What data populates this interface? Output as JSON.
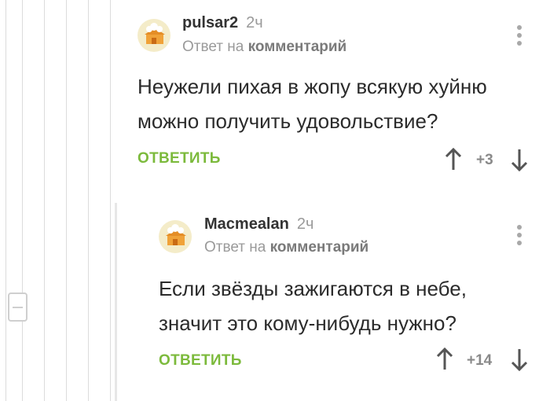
{
  "comments": [
    {
      "author": "pulsar2",
      "time": "2ч",
      "reply_prefix": "Ответ на",
      "reply_target": "комментарий",
      "text_lines": [
        "Неужели пихая в жопу всякую хуйню",
        "можно получить удовольствие?"
      ],
      "reply_label": "ОТВЕТИТЬ",
      "rating": "+3"
    },
    {
      "author": "Macmealan",
      "time": "2ч",
      "reply_prefix": "Ответ на",
      "reply_target": "комментарий",
      "text_lines": [
        "Если звёзды зажигаются в небе,",
        "значит это кому-нибудь нужно?"
      ],
      "reply_label": "ОТВЕТИТЬ",
      "rating": "+14"
    }
  ],
  "colors": {
    "accent_green": "#7cba3c",
    "muted_text": "#9a9a9a",
    "thread_line": "#dcdcdc"
  },
  "icons": [
    "avatar-placeholder",
    "more-vertical-icon",
    "arrow-up-icon",
    "arrow-down-icon",
    "collapse-minus-icon"
  ]
}
